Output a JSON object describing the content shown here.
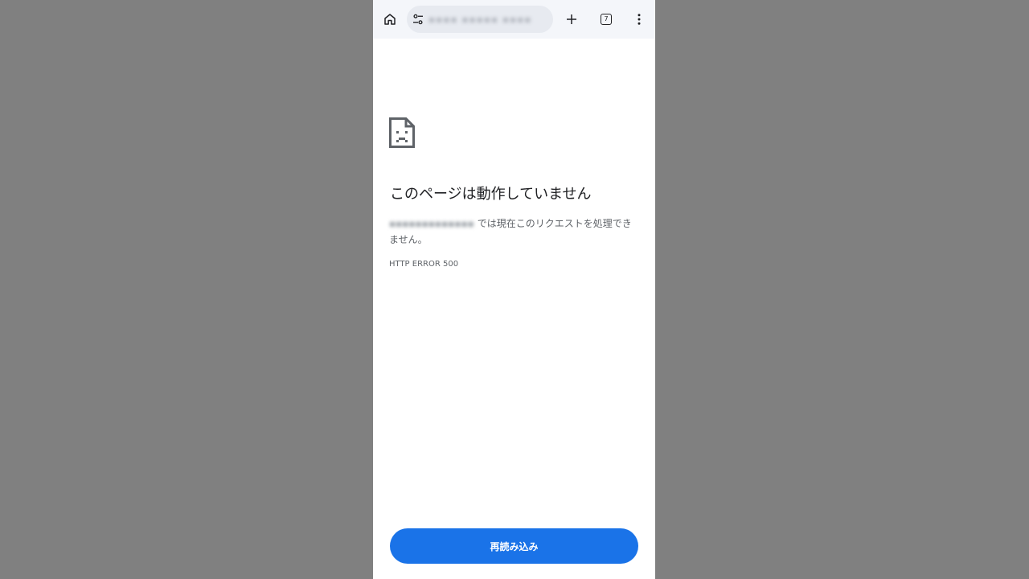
{
  "browser": {
    "url": "▪▪▪▪ ▪▪▪▪▪ ▪▪▪▪",
    "tab_count": "7"
  },
  "error": {
    "title": "このページは動作していません",
    "host_blurred": "▪▪▪▪▪▪▪▪▪▪▪▪▪",
    "message": "では現在このリクエストを処理できません。",
    "code": "HTTP ERROR 500"
  },
  "actions": {
    "reload_label": "再読み込み"
  },
  "colors": {
    "accent": "#1a73e8",
    "background_outside": "#808080",
    "toolbar": "#f4f6fa"
  },
  "icons": [
    "home-icon",
    "tune-icon",
    "plus-icon",
    "tab-switcher-icon",
    "more-vert-icon",
    "sad-page-icon"
  ]
}
